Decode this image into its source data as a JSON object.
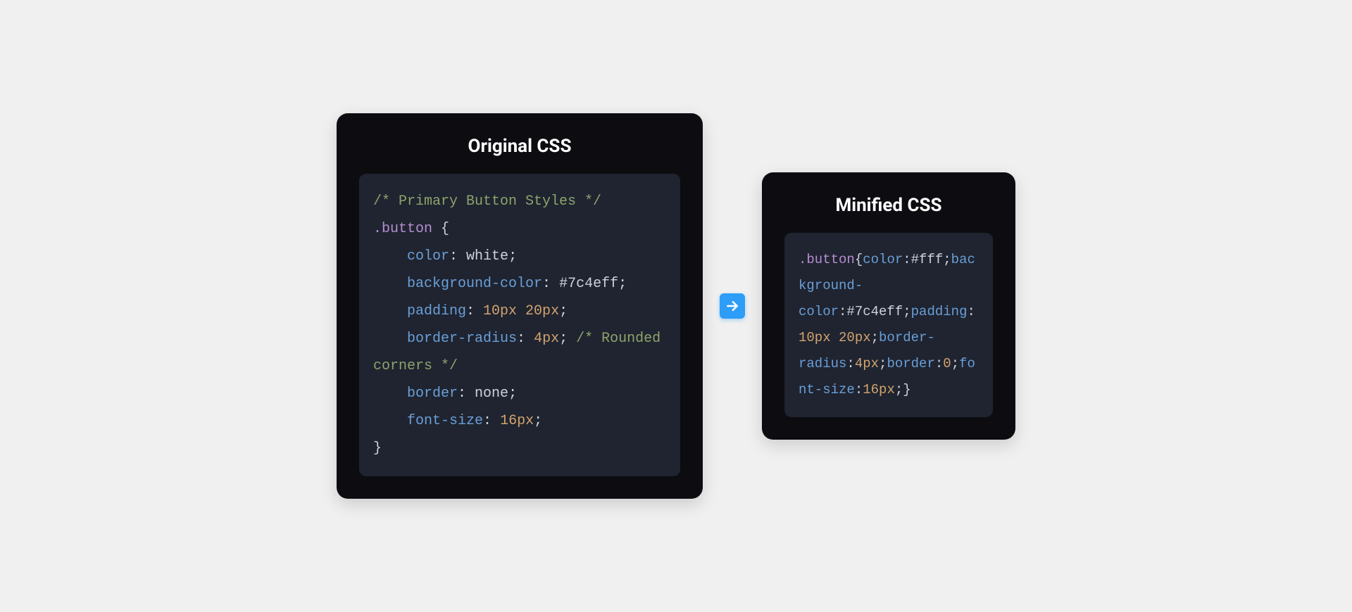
{
  "original": {
    "title": "Original CSS",
    "code": {
      "comment1": "/* Primary Button Styles */",
      "selector": ".button",
      "brace_open": " {",
      "prop_color": "color",
      "val_color": "white",
      "prop_bg": "background-color",
      "val_bg": "#7c4eff",
      "prop_padding": "padding",
      "val_padding": "10px 20px",
      "prop_radius": "border-radius",
      "val_radius": "4px",
      "comment2": "/* Rounded corners */",
      "prop_border": "border",
      "val_border": "none",
      "prop_fontsize": "font-size",
      "val_fontsize": "16px",
      "brace_close": "}"
    }
  },
  "minified": {
    "title": "Minified CSS",
    "code": {
      "selector": ".button",
      "brace_open": "{",
      "prop_color": "color",
      "val_color": "#fff",
      "prop_bg": "background-color",
      "val_bg": "#7c4eff",
      "prop_padding": "padding",
      "val_padding": "10px 20px",
      "prop_radius": "border-radius",
      "val_radius": "4px",
      "prop_border": "border",
      "val_border": "0",
      "prop_fontsize": "font-size",
      "val_fontsize": "16px",
      "brace_close": "}"
    }
  }
}
